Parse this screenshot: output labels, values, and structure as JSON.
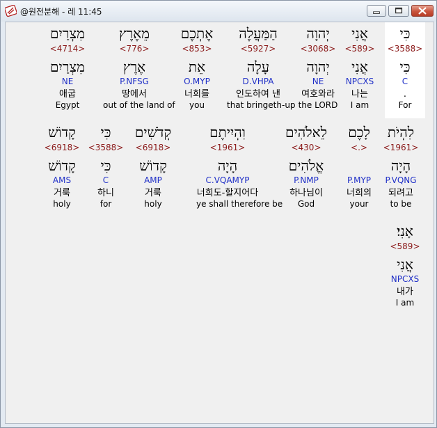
{
  "window": {
    "title": "@원전분해 - 레 11:45"
  },
  "rows": [
    [
      {
        "heb": "כִּי",
        "num": "<3588>",
        "lemma": "כִּי",
        "gram": "C",
        "kor": ".",
        "eng": "For",
        "hl": true
      },
      {
        "heb": "אֲנִי",
        "num": "<589>",
        "lemma": "אֲנִי",
        "gram": "NPCXS",
        "kor": "나는",
        "eng": "I am"
      },
      {
        "heb": "יְהוָה",
        "num": "<3068>",
        "lemma": "יְהוָה",
        "gram": "NE",
        "kor": "여호와라",
        "eng": "the LORD"
      },
      {
        "heb": "הַמַּעֲלֶה",
        "num": "<5927>",
        "lemma": "עָלָה",
        "gram": "D.VHPA",
        "kor": "인도하여 낸",
        "eng": "that bringeth-up"
      },
      {
        "heb": "אֶתְכֶם",
        "num": "<853>",
        "lemma": "אֵת",
        "gram": "O.MYP",
        "kor": "너희를",
        "eng": "you"
      },
      {
        "heb": "מֵאֶרֶץ",
        "num": "<776>",
        "lemma": "אֶרֶץ",
        "gram": "P.NFSG",
        "kor": "땅에서",
        "eng": "out of the land of"
      },
      {
        "heb": "מִצְרַיִם",
        "num": "<4714>",
        "lemma": "מִצְרַיִם",
        "gram": "NE",
        "kor": "애굽",
        "eng": "Egypt"
      }
    ],
    [
      {
        "heb": "לִהְיֹת",
        "num": "<1961>",
        "lemma": "הָיָה",
        "gram": "P.VQNG",
        "kor": "되려고",
        "eng": "to be"
      },
      {
        "heb": "לָכֶם",
        "num": "<.>",
        "lemma": "",
        "gram": "P.MYP",
        "kor": "너희의",
        "eng": "your"
      },
      {
        "heb": "לֵאלֹהִים",
        "num": "<430>",
        "lemma": "אֱלֹהִים",
        "gram": "P.NMP",
        "kor": "하나님이",
        "eng": "God"
      },
      {
        "heb": "וִהְיִיתֶם",
        "num": "<1961>",
        "lemma": "הָיָה",
        "gram": "C.VQAMYP",
        "kor": "너희도-할지어다",
        "eng": "ye shall therefore be"
      },
      {
        "heb": "קְדֹשִׁים",
        "num": "<6918>",
        "lemma": "קָדוֹשׁ",
        "gram": "AMP",
        "kor": "거룩",
        "eng": "holy"
      },
      {
        "heb": "כִּי",
        "num": "<3588>",
        "lemma": "כִּי",
        "gram": "C",
        "kor": "하니",
        "eng": "for"
      },
      {
        "heb": "קָדוֹשׁ",
        "num": "<6918>",
        "lemma": "קָדוֹשׁ",
        "gram": "AMS",
        "kor": "거룩",
        "eng": "holy"
      }
    ],
    [
      {
        "heb": "אָנִי׃",
        "num": "<589>",
        "lemma": "אֲנִי",
        "gram": "NPCXS",
        "kor": "내가",
        "eng": "I am"
      }
    ]
  ]
}
